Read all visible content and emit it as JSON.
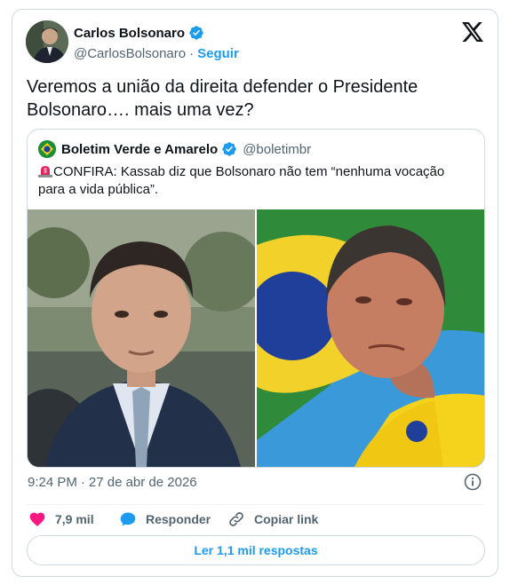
{
  "author": {
    "name": "Carlos Bolsonaro",
    "handle": "@CarlosBolsonaro",
    "separator": "·",
    "follow_label": "Seguir"
  },
  "tweet": {
    "text": "Veremos a união da direita defender o Presidente Bolsonaro…. mais uma vez?"
  },
  "quoted": {
    "name": "Boletim Verde e Amarelo",
    "handle": "@boletimbr",
    "text": "CONFIRA: Kassab diz que Bolsonaro não tem “nenhuma vocação para a vida pública”."
  },
  "meta": {
    "time": "9:24 PM",
    "separator": "·",
    "date": "27 de abr de 2026"
  },
  "actions": {
    "likes": "7,9 mil",
    "reply_label": "Responder",
    "copy_label": "Copiar link"
  },
  "read_replies_label": "Ler 1,1 mil respostas",
  "colors": {
    "accent": "#1d9bf0",
    "like": "#f91880",
    "text": "#0f1419",
    "muted": "#536471",
    "border": "#cfd9de"
  },
  "icons": [
    "x-logo-icon",
    "verified-badge-icon",
    "siren-icon",
    "info-icon",
    "heart-icon",
    "reply-bubble-icon",
    "link-icon"
  ]
}
